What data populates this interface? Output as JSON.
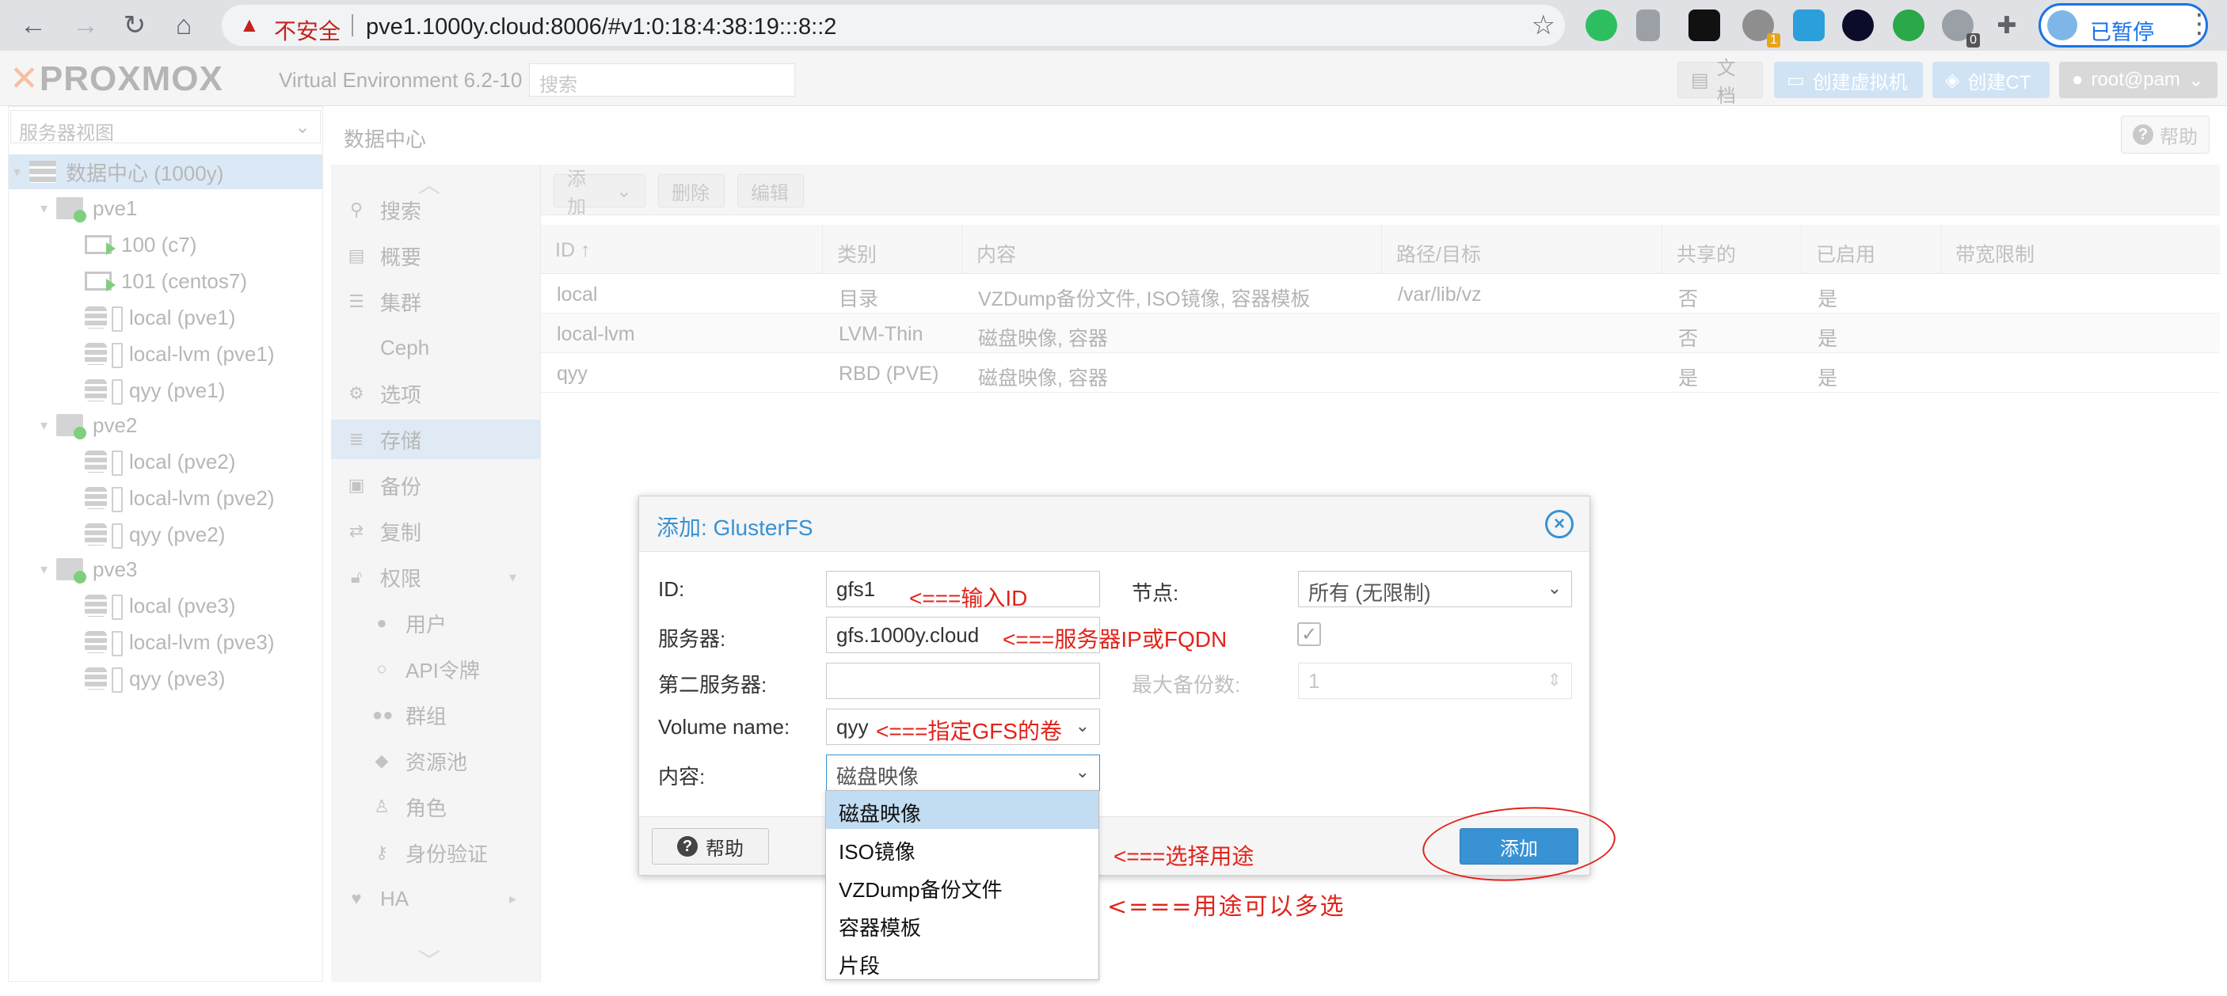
{
  "browser": {
    "insecure_label": "不安全",
    "url": "pve1.1000y.cloud:8006/#v1:0:18:4:38:19:::8::2",
    "profile_label": "已暂停",
    "ext_badges": [
      "1",
      "0"
    ]
  },
  "header": {
    "logo": "PROXMOX",
    "version": "Virtual Environment 6.2-10",
    "search_placeholder": "搜索",
    "docs_label": "文档",
    "create_vm_label": "创建虚拟机",
    "create_ct_label": "创建CT",
    "user_label": "root@pam"
  },
  "tree": {
    "view_select": "服务器视图",
    "items": [
      {
        "label": "数据中心 (1000y)",
        "type": "datacenter"
      },
      {
        "label": "pve1",
        "type": "node"
      },
      {
        "label": "100 (c7)",
        "type": "vm"
      },
      {
        "label": "101 (centos7)",
        "type": "vm"
      },
      {
        "label": "local (pve1)",
        "type": "storage"
      },
      {
        "label": "local-lvm (pve1)",
        "type": "storage"
      },
      {
        "label": "qyy (pve1)",
        "type": "storage"
      },
      {
        "label": "pve2",
        "type": "node"
      },
      {
        "label": "local (pve2)",
        "type": "storage"
      },
      {
        "label": "local-lvm (pve2)",
        "type": "storage"
      },
      {
        "label": "qyy (pve2)",
        "type": "storage"
      },
      {
        "label": "pve3",
        "type": "node"
      },
      {
        "label": "local (pve3)",
        "type": "storage"
      },
      {
        "label": "local-lvm (pve3)",
        "type": "storage"
      },
      {
        "label": "qyy (pve3)",
        "type": "storage"
      }
    ]
  },
  "main": {
    "title": "数据中心",
    "help_label": "帮助",
    "nav": [
      {
        "label": "搜索",
        "icon": "search-icon"
      },
      {
        "label": "概要",
        "icon": "book-icon"
      },
      {
        "label": "集群",
        "icon": "server-icon"
      },
      {
        "label": "Ceph",
        "icon": "ceph-icon"
      },
      {
        "label": "选项",
        "icon": "gear-icon"
      },
      {
        "label": "存储",
        "icon": "database-icon"
      },
      {
        "label": "备份",
        "icon": "floppy-icon"
      },
      {
        "label": "复制",
        "icon": "retweet-icon"
      },
      {
        "label": "权限",
        "icon": "unlock-icon"
      },
      {
        "label": "用户",
        "icon": "user-icon"
      },
      {
        "label": "API令牌",
        "icon": "user-outline-icon"
      },
      {
        "label": "群组",
        "icon": "users-icon"
      },
      {
        "label": "资源池",
        "icon": "tags-icon"
      },
      {
        "label": "角色",
        "icon": "male-icon"
      },
      {
        "label": "身份验证",
        "icon": "key-icon"
      },
      {
        "label": "HA",
        "icon": "heartbeat-icon"
      }
    ],
    "toolbar": {
      "add": "添加",
      "remove": "删除",
      "edit": "编辑"
    },
    "columns": [
      "ID ↑",
      "类别",
      "内容",
      "路径/目标",
      "共享的",
      "已启用",
      "带宽限制"
    ],
    "rows": [
      [
        "local",
        "目录",
        "VZDump备份文件, ISO镜像, 容器模板",
        "/var/lib/vz",
        "否",
        "是",
        ""
      ],
      [
        "local-lvm",
        "LVM-Thin",
        "磁盘映像, 容器",
        "",
        "否",
        "是",
        ""
      ],
      [
        "qyy",
        "RBD (PVE)",
        "磁盘映像, 容器",
        "",
        "是",
        "是",
        ""
      ]
    ]
  },
  "dialog": {
    "title": "添加: GlusterFS",
    "id_label": "ID:",
    "id_value": "gfs1",
    "server_label": "服务器:",
    "server_value": "gfs.1000y.cloud",
    "server2_label": "第二服务器:",
    "server2_value": "",
    "volume_label": "Volume name:",
    "volume_value": "qyy",
    "content_label": "内容:",
    "content_value": "磁盘映像",
    "nodes_label": "节点:",
    "nodes_value": "所有 (无限制)",
    "maxbackups_label": "最大备份数:",
    "maxbackups_value": "1",
    "enable_checked": "✓",
    "help_label": "帮助",
    "add_label": "添加",
    "content_options": [
      "磁盘映像",
      "ISO镜像",
      "VZDump备份文件",
      "容器模板",
      "片段"
    ]
  },
  "annotations": {
    "id_note": "<===输入ID",
    "server_note": "<===服务器IP或FQDN",
    "volume_note": "<===指定GFS的卷",
    "content_note": "<===选择用途",
    "multi_note": "<===用途可以多选"
  },
  "colors": {
    "accent": "#3892d4",
    "annotation": "#e2231a",
    "selection": "#c2dcf2"
  }
}
